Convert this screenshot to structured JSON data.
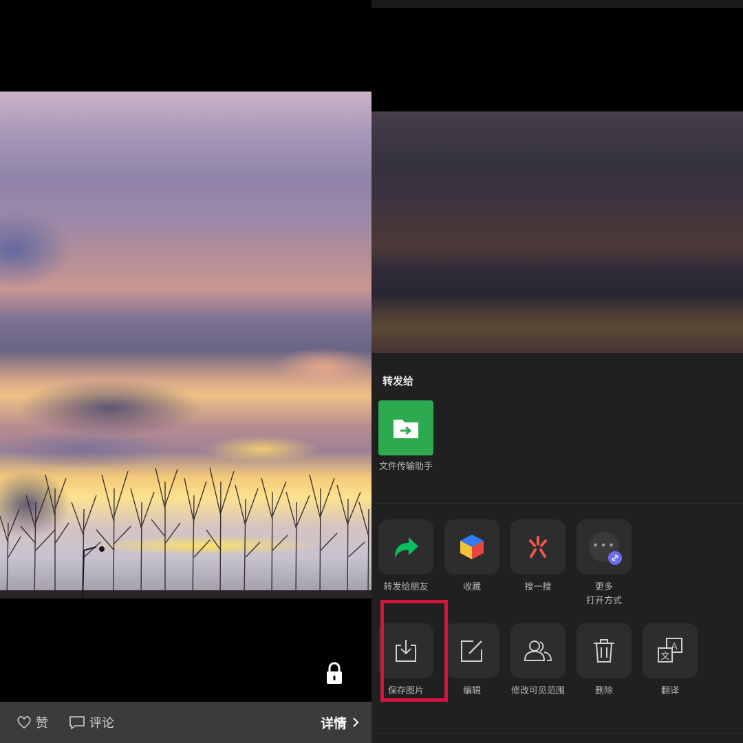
{
  "left": {
    "actions": {
      "like_label": "赞",
      "comment_label": "评论",
      "detail_label": "详情"
    },
    "icons": [
      "heart-icon",
      "comment-icon",
      "chevron-right-icon",
      "lock-icon"
    ]
  },
  "sheet": {
    "title": "转发给",
    "contact": {
      "name": "文件传输助手",
      "tile_color": "#2daa4f"
    },
    "row1": [
      {
        "label": "转发给朋友",
        "icon": "forward-arrow-icon"
      },
      {
        "label": "收藏",
        "icon": "favorite-cube-icon"
      },
      {
        "label": "搜一搜",
        "icon": "search-one-search-icon"
      },
      {
        "label": "更多\n打开方式",
        "icon": "more-open-with-icon"
      }
    ],
    "row2": [
      {
        "label": "保存图片",
        "icon": "save-image-icon"
      },
      {
        "label": "编辑",
        "icon": "edit-icon"
      },
      {
        "label": "修改可见范围",
        "icon": "visibility-range-icon"
      },
      {
        "label": "删除",
        "icon": "trash-icon"
      },
      {
        "label": "翻译",
        "icon": "translate-icon"
      }
    ]
  },
  "colors": {
    "highlight": "#d4163f",
    "sheet_background": "#202020",
    "accent_green": "#07c160"
  }
}
